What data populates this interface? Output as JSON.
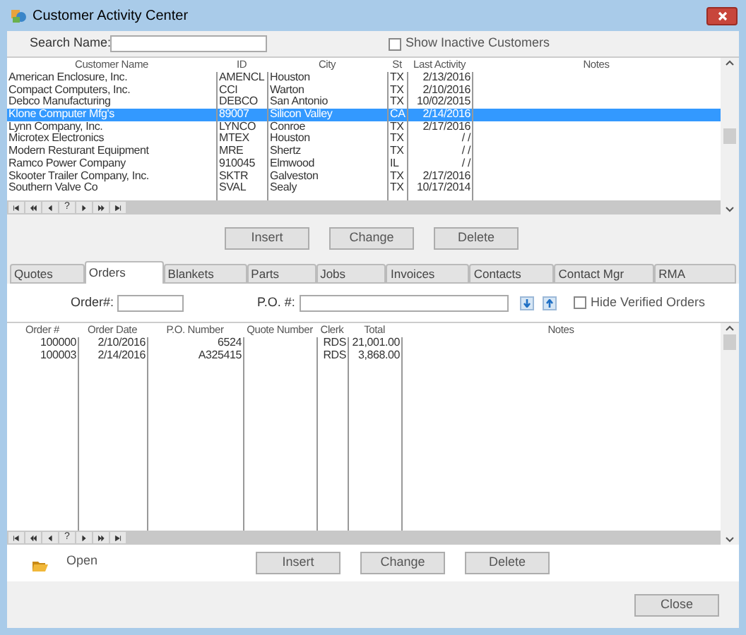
{
  "window": {
    "title": "Customer Activity Center"
  },
  "search": {
    "label": "Search Name:"
  },
  "show_inactive": {
    "label": "Show Inactive Customers",
    "checked": false
  },
  "customers": {
    "columns": [
      "Customer Name",
      "ID",
      "City",
      "St",
      "Last Activity",
      "Notes"
    ],
    "navigator_help": "?",
    "rows": [
      {
        "cells": [
          "American Enclosure, Inc.",
          "AMENCL",
          "Houston",
          "TX",
          "2/13/2016"
        ],
        "selected": false
      },
      {
        "cells": [
          "Compact Computers, Inc.",
          "CCI",
          "Warton",
          "TX",
          "2/10/2016"
        ],
        "selected": false
      },
      {
        "cells": [
          "Debco Manufacturing",
          "DEBCO",
          "San Antonio",
          "TX",
          "10/02/2015"
        ],
        "selected": false
      },
      {
        "cells": [
          "Klone Computer Mfg's",
          "89007",
          "Silicon Valley",
          "CA",
          "2/14/2016"
        ],
        "selected": true
      },
      {
        "cells": [
          "Lynn Company, Inc.",
          "LYNCO",
          "Conroe",
          "TX",
          "2/17/2016"
        ],
        "selected": false
      },
      {
        "cells": [
          "Microtex Electronics",
          "MTEX",
          "Houston",
          "TX",
          "/ /"
        ],
        "selected": false
      },
      {
        "cells": [
          "Modern Resturant Equipment",
          "MRE",
          "Shertz",
          "TX",
          "/ /"
        ],
        "selected": false
      },
      {
        "cells": [
          "Ramco Power Company",
          "910045",
          "Elmwood",
          "IL",
          "/ /"
        ],
        "selected": false
      },
      {
        "cells": [
          "Skooter Trailer Company, Inc.",
          "SKTR",
          "Galveston",
          "TX",
          "2/17/2016"
        ],
        "selected": false
      },
      {
        "cells": [
          "Southern Valve Co",
          "SVAL",
          "Sealy",
          "TX",
          "10/17/2014"
        ],
        "selected": false
      }
    ]
  },
  "customer_buttons": [
    "Insert",
    "Change",
    "Delete"
  ],
  "tabs": [
    {
      "label": "Quotes",
      "selected": false
    },
    {
      "label": "Orders",
      "selected": true
    },
    {
      "label": "Blankets",
      "selected": false
    },
    {
      "label": "Parts",
      "selected": false
    },
    {
      "label": "Jobs",
      "selected": false
    },
    {
      "label": "Invoices",
      "selected": false
    },
    {
      "label": "Contacts",
      "selected": false
    },
    {
      "label": "Contact Mgr",
      "selected": false
    },
    {
      "label": "RMA",
      "selected": false
    }
  ],
  "order_filter": {
    "order_label": "Order#:",
    "po_label": "P.O. #:",
    "hide_verified": {
      "label": "Hide Verified Orders",
      "checked": false
    }
  },
  "orders": {
    "columns": [
      "Order #",
      "Order Date",
      "P.O. Number",
      "Quote Number",
      "Clerk",
      "Total",
      "Notes"
    ],
    "navigator_help": "?",
    "rows": [
      {
        "cells": [
          "100000",
          "2/10/2016",
          "6524",
          "",
          "RDS",
          "21,001.00",
          ""
        ]
      },
      {
        "cells": [
          "100003",
          "2/14/2016",
          "A325415",
          "",
          "RDS",
          "3,868.00",
          ""
        ]
      }
    ]
  },
  "open_label": "Open",
  "order_buttons": [
    "Insert",
    "Change",
    "Delete"
  ],
  "close_button": "Close"
}
